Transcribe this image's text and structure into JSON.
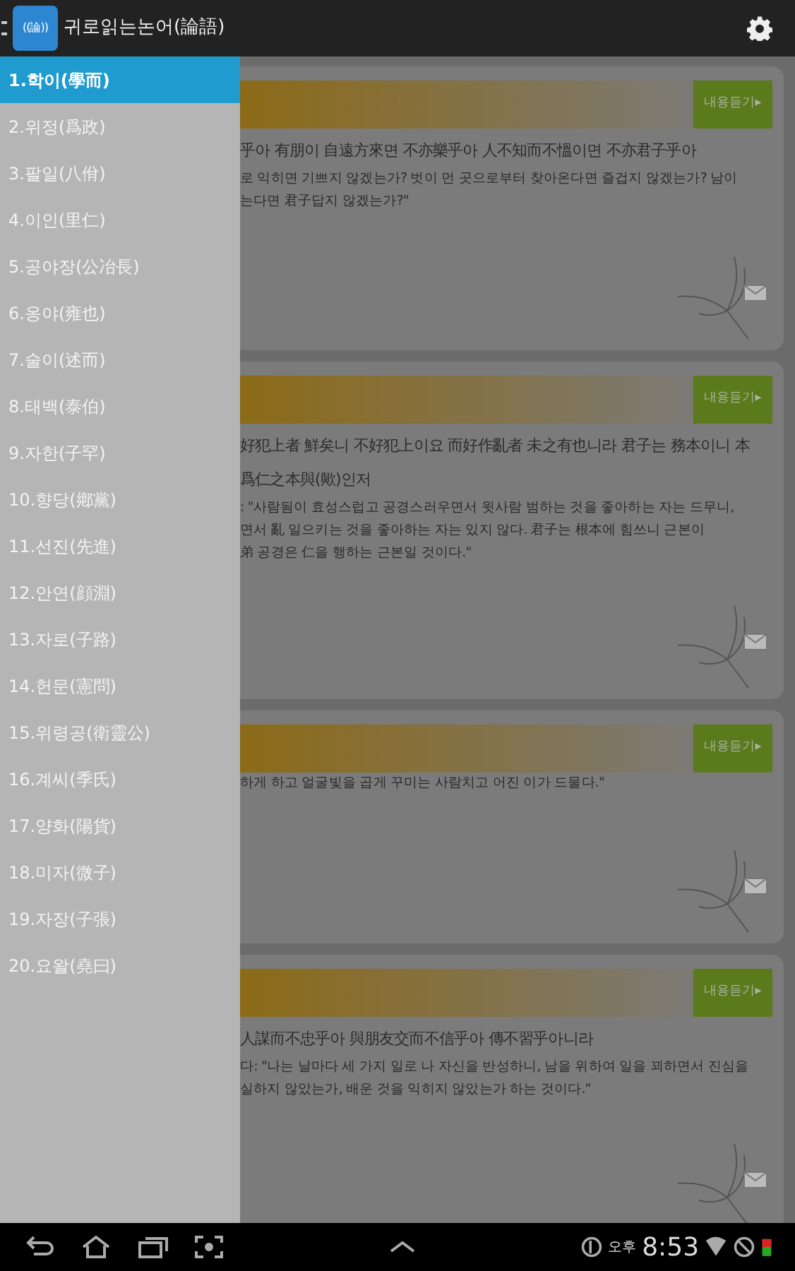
{
  "app_bar": {
    "icon_glyph": "((論))",
    "title": "귀로읽는논어(論語)"
  },
  "drawer": {
    "items": [
      {
        "label": "1.학이(學而)",
        "selected": true
      },
      {
        "label": "2.위정(爲政)",
        "selected": false
      },
      {
        "label": "3.팔일(八佾)",
        "selected": false
      },
      {
        "label": "4.이인(里仁)",
        "selected": false
      },
      {
        "label": "5.공야장(公冶長)",
        "selected": false
      },
      {
        "label": "6.옹야(雍也)",
        "selected": false
      },
      {
        "label": "7.술이(述而)",
        "selected": false
      },
      {
        "label": "8.태백(泰伯)",
        "selected": false
      },
      {
        "label": "9.자한(子罕)",
        "selected": false
      },
      {
        "label": "10.향당(鄕黨)",
        "selected": false
      },
      {
        "label": "11.선진(先進)",
        "selected": false
      },
      {
        "label": "12.안연(顔淵)",
        "selected": false
      },
      {
        "label": "13.자로(子路)",
        "selected": false
      },
      {
        "label": "14.헌문(憲問)",
        "selected": false
      },
      {
        "label": "15.위령공(衛靈公)",
        "selected": false
      },
      {
        "label": "16.계씨(季氏)",
        "selected": false
      },
      {
        "label": "17.양화(陽貨)",
        "selected": false
      },
      {
        "label": "18.미자(微子)",
        "selected": false
      },
      {
        "label": "19.자장(子張)",
        "selected": false
      },
      {
        "label": "20.요왈(堯曰)",
        "selected": false
      }
    ]
  },
  "cards": [
    {
      "button": "내용듣기▸",
      "lines": [
        {
          "kind": "original",
          "text": "乎아 有朋이 自遠方來면 不亦樂乎아 人不知而不慍이면 不亦君子乎아"
        },
        {
          "kind": "translation",
          "text": "로 익히면 기쁘지 않겠는가? 벗이 먼 곳으로부터 찾아온다면 즐겁지 않겠는가? 남이"
        },
        {
          "kind": "translation",
          "text": "는다면 君子답지 않겠는가?\""
        }
      ]
    },
    {
      "button": "내용듣기▸",
      "lines": [
        {
          "kind": "original",
          "text": "好犯上者 鮮矣니 不好犯上이요 而好作亂者 未之有也니라 君子는 務本이니 本"
        },
        {
          "kind": "original",
          "text": "爲仁之本與(歟)인저"
        },
        {
          "kind": "translation",
          "text": ": \"사람됨이 효성스럽고 공경스러우면서 윗사람 범하는 것을 좋아하는 자는 드무니,"
        },
        {
          "kind": "translation",
          "text": "면서 亂 일으키는 것을 좋아하는 자는 있지 않다. 君子는 根本에 힘쓰니 근본이"
        },
        {
          "kind": "translation",
          "text": "弟 공경은 仁을 행하는 근본일 것이다.\""
        }
      ]
    },
    {
      "button": "내용듣기▸",
      "lines": [
        {
          "kind": "translation",
          "text": "하게 하고 얼굴빛을 곱게 꾸미는 사람치고 어진 이가 드물다.\""
        }
      ]
    },
    {
      "button": "내용듣기▸",
      "lines": [
        {
          "kind": "original",
          "text": "人謀而不忠乎아 與朋友交而不信乎아 傳不習乎아니라"
        },
        {
          "kind": "translation",
          "text": "다: \"나는 날마다 세 가지 일로 나 자신을 반성하니, 남을 위하여 일을 꾀하면서 진심을"
        },
        {
          "kind": "translation",
          "text": "실하지 않았는가, 배운 것을 익히지 않았는가 하는 것이다.\""
        }
      ]
    }
  ],
  "status_bar": {
    "ampm": "오후",
    "time": "8:53"
  }
}
